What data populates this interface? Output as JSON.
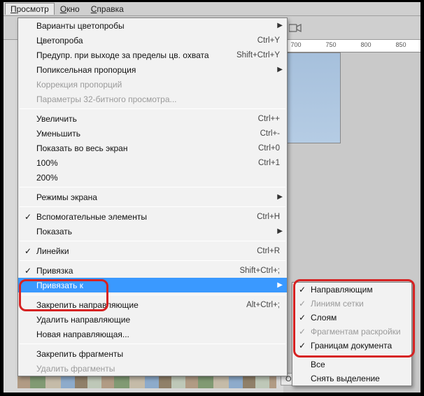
{
  "menubar": {
    "items": [
      {
        "label": "Просмотр",
        "accel": "П",
        "open": true
      },
      {
        "label": "Окно",
        "accel": "О",
        "open": false
      },
      {
        "label": "Справка",
        "accel": "С",
        "open": false
      }
    ]
  },
  "ruler": {
    "marks": [
      "700",
      "750",
      "800",
      "850"
    ]
  },
  "bottom_tab": "Обь",
  "dropdown": [
    {
      "type": "item",
      "label": "Варианты цветопробы",
      "submenu": true
    },
    {
      "type": "item",
      "label": "Цветопроба",
      "shortcut": "Ctrl+Y"
    },
    {
      "type": "item",
      "label": "Предупр. при выходе за пределы цв. охвата",
      "shortcut": "Shift+Ctrl+Y"
    },
    {
      "type": "item",
      "label": "Попиксельная пропорция",
      "submenu": true
    },
    {
      "type": "item",
      "label": "Коррекция пропорций",
      "disabled": true
    },
    {
      "type": "item",
      "label": "Параметры 32-битного просмотра...",
      "disabled": true
    },
    {
      "type": "sep"
    },
    {
      "type": "item",
      "label": "Увеличить",
      "shortcut": "Ctrl++"
    },
    {
      "type": "item",
      "label": "Уменьшить",
      "shortcut": "Ctrl+-"
    },
    {
      "type": "item",
      "label": "Показать во весь экран",
      "shortcut": "Ctrl+0"
    },
    {
      "type": "item",
      "label": "100%",
      "shortcut": "Ctrl+1"
    },
    {
      "type": "item",
      "label": "200%"
    },
    {
      "type": "sep"
    },
    {
      "type": "item",
      "label": "Режимы экрана",
      "submenu": true
    },
    {
      "type": "sep"
    },
    {
      "type": "item",
      "label": "Вспомогательные элементы",
      "shortcut": "Ctrl+H",
      "checked": true
    },
    {
      "type": "item",
      "label": "Показать",
      "submenu": true
    },
    {
      "type": "sep"
    },
    {
      "type": "item",
      "label": "Линейки",
      "shortcut": "Ctrl+R",
      "checked": true
    },
    {
      "type": "sep"
    },
    {
      "type": "item",
      "label": "Привязка",
      "shortcut": "Shift+Ctrl+;",
      "checked": true
    },
    {
      "type": "item",
      "label": "Привязать к",
      "submenu": true,
      "highlighted": true
    },
    {
      "type": "sep"
    },
    {
      "type": "item",
      "label": "Закрепить направляющие",
      "shortcut": "Alt+Ctrl+;"
    },
    {
      "type": "item",
      "label": "Удалить направляющие"
    },
    {
      "type": "item",
      "label": "Новая направляющая..."
    },
    {
      "type": "sep"
    },
    {
      "type": "item",
      "label": "Закрепить фрагменты"
    },
    {
      "type": "item",
      "label": "Удалить фрагменты",
      "disabled": true
    }
  ],
  "submenu": [
    {
      "type": "item",
      "label": "Направляющим",
      "checked": true
    },
    {
      "type": "item",
      "label": "Линиям сетки",
      "checked": true,
      "disabled": true
    },
    {
      "type": "item",
      "label": "Слоям",
      "checked": true
    },
    {
      "type": "item",
      "label": "Фрагментам раскройки",
      "checked": true,
      "disabled": true
    },
    {
      "type": "item",
      "label": "Границам документа",
      "checked": true
    },
    {
      "type": "sep"
    },
    {
      "type": "item",
      "label": "Все"
    },
    {
      "type": "item",
      "label": "Снять выделение"
    }
  ]
}
